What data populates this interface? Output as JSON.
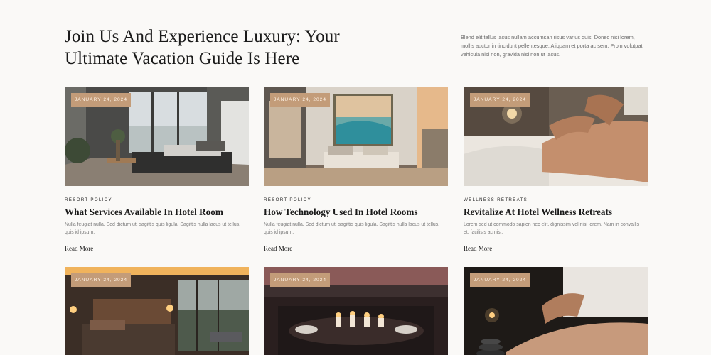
{
  "section": {
    "title": "Join Us And Experience Luxury: Your Ultimate Vacation Guide Is Here",
    "intro": "Blend elit tellus lacus nullam accumsan risus varius quis. Donec nisi lorem, mollis auctor in tincidunt pellentesque. Aliquam et porta ac sem. Proin volutpat, vehicula nisl non, gravida nisi non ut lacus."
  },
  "cards": [
    {
      "badge": "January 24, 2024",
      "category": "Resort Policy",
      "title": "What Services Available In Hotel Room",
      "excerpt": "Nulla feugiat nulla. Sed dictum ut, sagittis quis ligula, Sagittis nulla lacus ut tellus, quis id ipsum.",
      "read_more": "Read More"
    },
    {
      "badge": "January 24, 2024",
      "category": "Resort Policy",
      "title": "How Technology Used In Hotel Rooms",
      "excerpt": "Nulla feugiat nulla. Sed dictum ut, sagittis quis ligula, Sagittis nulla lacus ut tellus, quis id ipsum.",
      "read_more": "Read More"
    },
    {
      "badge": "January 24, 2024",
      "category": "Wellness Retreats",
      "title": "Revitalize At Hotel Wellness Retreats",
      "excerpt": "Lorem sed ut commodo sapien nec elit, dignissim vel nisi lorem. Nam in convallis et, facilisis ac nisl.",
      "read_more": "Read More"
    },
    {
      "badge": "January 24, 2024"
    },
    {
      "badge": "January 24, 2024"
    },
    {
      "badge": "January 24, 2024"
    }
  ],
  "colors": {
    "badge": "#c39c79",
    "background": "#faf9f7",
    "heading": "#1a1a1a"
  }
}
